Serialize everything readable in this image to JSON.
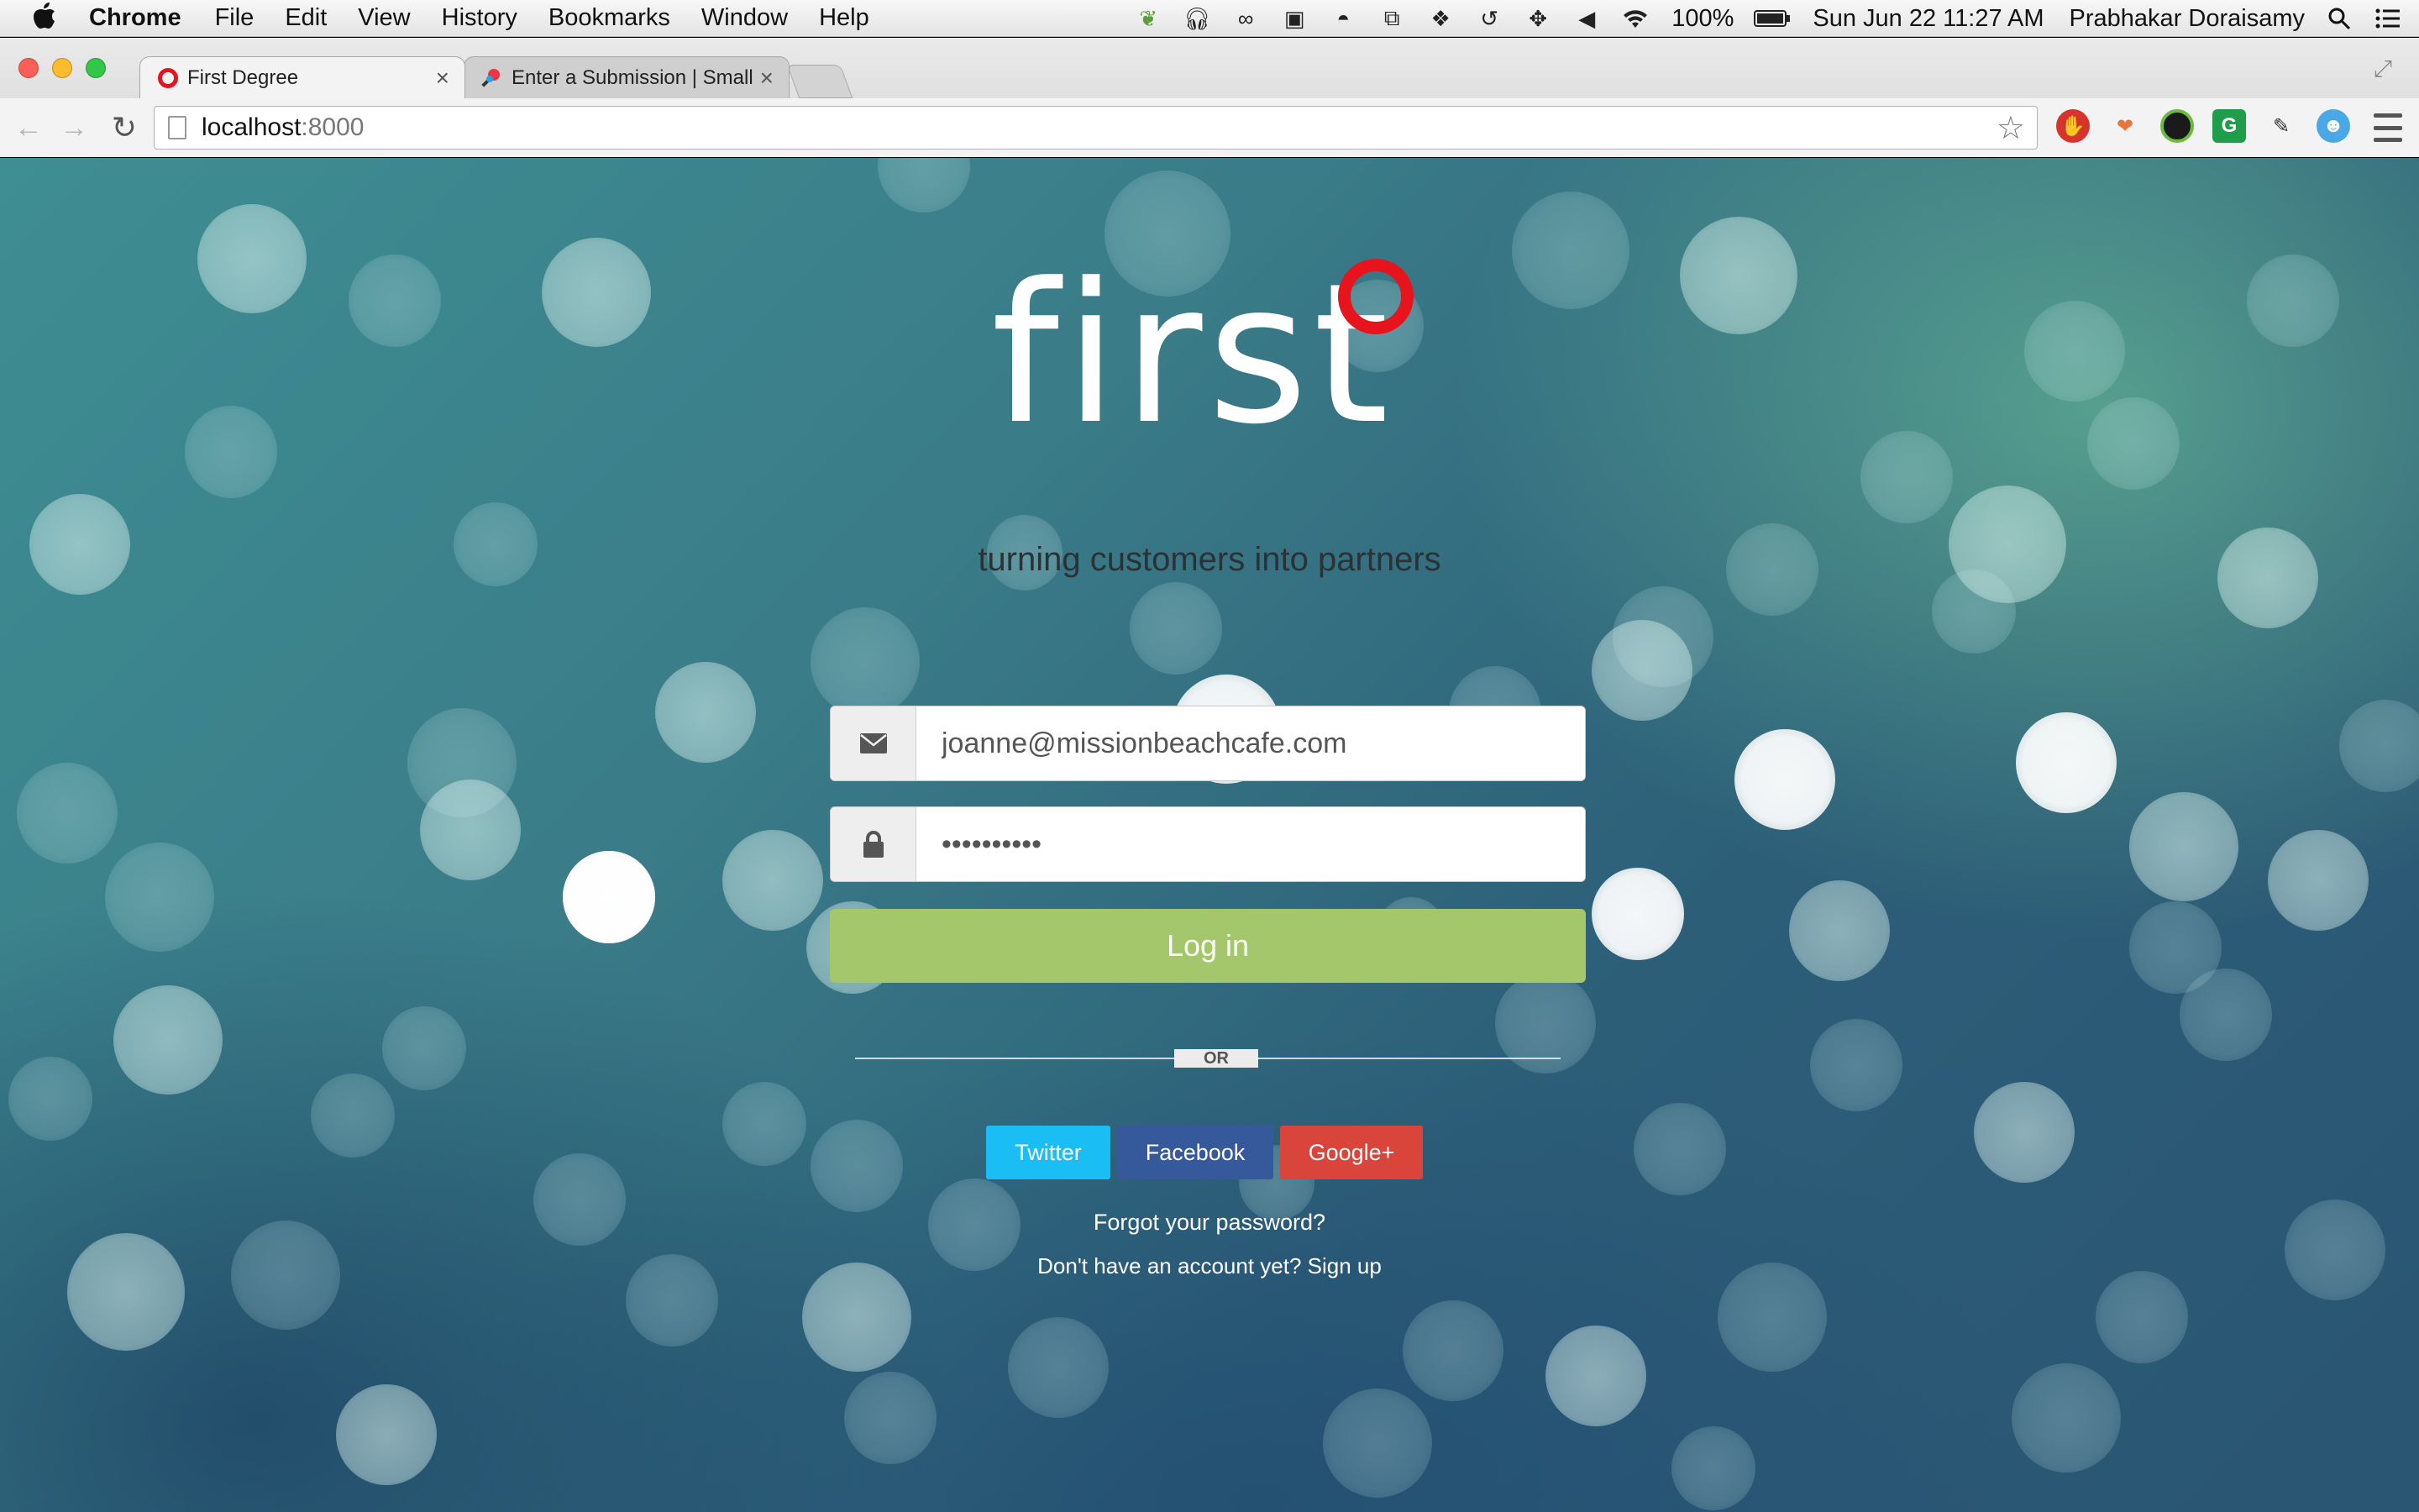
{
  "menubar": {
    "app_name": "Chrome",
    "items": [
      "File",
      "Edit",
      "View",
      "History",
      "Bookmarks",
      "Window",
      "Help"
    ],
    "battery": "100%",
    "clock": "Sun Jun 22  11:27 AM",
    "user": "Prabhakar Doraisamy"
  },
  "browser": {
    "tabs": [
      {
        "title": "First Degree",
        "active": true
      },
      {
        "title": "Enter a Submission | Small",
        "active": false
      }
    ],
    "url_host": "localhost",
    "url_port": ":8000"
  },
  "page": {
    "logo_text": "first",
    "tagline": "turning customers into partners",
    "email_value": "joanne@missionbeachcafe.com",
    "password_value": "••••••••••",
    "login_label": "Log in",
    "or_label": "OR",
    "social": {
      "twitter": "Twitter",
      "facebook": "Facebook",
      "google": "Google+"
    },
    "forgot_label": "Forgot your password?",
    "signup_label": "Don't have an account yet? Sign up"
  },
  "colors": {
    "brand_red": "#e8141d",
    "login_green": "#a3c76a",
    "twitter": "#1bbdf5",
    "facebook": "#36599b",
    "google": "#d9453a"
  }
}
